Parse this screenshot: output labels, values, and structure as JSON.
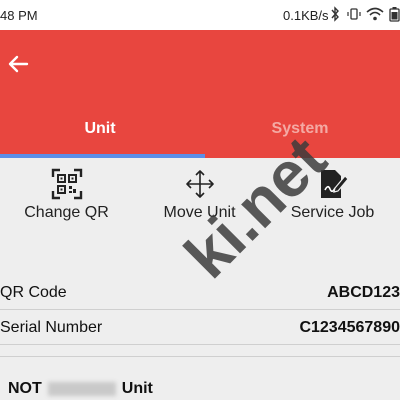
{
  "status_bar": {
    "time": "48 PM",
    "network_speed": "0.1KB/s",
    "icons": [
      "bluetooth-icon",
      "vibrate-icon",
      "wifi-icon",
      "battery-icon"
    ]
  },
  "app_bar": {
    "back_icon": "arrow-left-icon",
    "color": "#e8463f"
  },
  "tabs": [
    {
      "label": "Unit",
      "active": true
    },
    {
      "label": "System",
      "active": false
    }
  ],
  "actions": [
    {
      "label": "Change QR",
      "icon": "qr-scan-icon"
    },
    {
      "label": "Move Unit",
      "icon": "move-arrows-icon"
    },
    {
      "label": "Service Job",
      "icon": "service-job-icon"
    }
  ],
  "details": [
    {
      "label": "QR Code",
      "value": "ABCD123"
    },
    {
      "label": "Serial Number",
      "value": "C1234567890"
    }
  ],
  "unit_status": {
    "prefix": "NOT",
    "suffix": "Unit"
  },
  "watermark": "ki.net",
  "colors": {
    "accent": "#e8463f",
    "tab_indicator": "#5b8ee8",
    "background": "#eeeeee"
  }
}
